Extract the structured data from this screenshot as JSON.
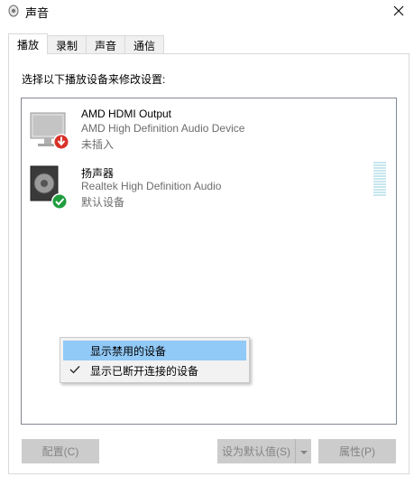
{
  "window": {
    "title": "声音",
    "title_icon": "speaker-icon",
    "close_icon": "close-icon"
  },
  "tabs": [
    {
      "label": "播放",
      "active": true
    },
    {
      "label": "录制",
      "active": false
    },
    {
      "label": "声音",
      "active": false
    },
    {
      "label": "通信",
      "active": false
    }
  ],
  "prompt": "选择以下播放设备来修改设置:",
  "devices": [
    {
      "name": "AMD HDMI Output",
      "description": "AMD High Definition Audio Device",
      "status": "未插入",
      "icon": "monitor-icon",
      "badge": "unplugged-arrow-badge",
      "badge_color": "#d9312b"
    },
    {
      "name": "扬声器",
      "description": "Realtek High Definition Audio",
      "status": "默认设备",
      "icon": "speaker-device-icon",
      "badge": "default-check-badge",
      "badge_color": "#1f9d3f",
      "meter_level": 0
    }
  ],
  "context_menu": {
    "items": [
      {
        "label": "显示禁用的设备",
        "checked": false,
        "highlighted": true
      },
      {
        "label": "显示已断开连接的设备",
        "checked": true,
        "highlighted": false
      }
    ]
  },
  "buttons": {
    "configure": "配置(C)",
    "set_default": "设为默认值(S)",
    "properties": "属性(P)"
  },
  "colors": {
    "highlight": "#91c9f7",
    "disabled_button": "#cccccc",
    "meter": "#c7e6ef"
  }
}
